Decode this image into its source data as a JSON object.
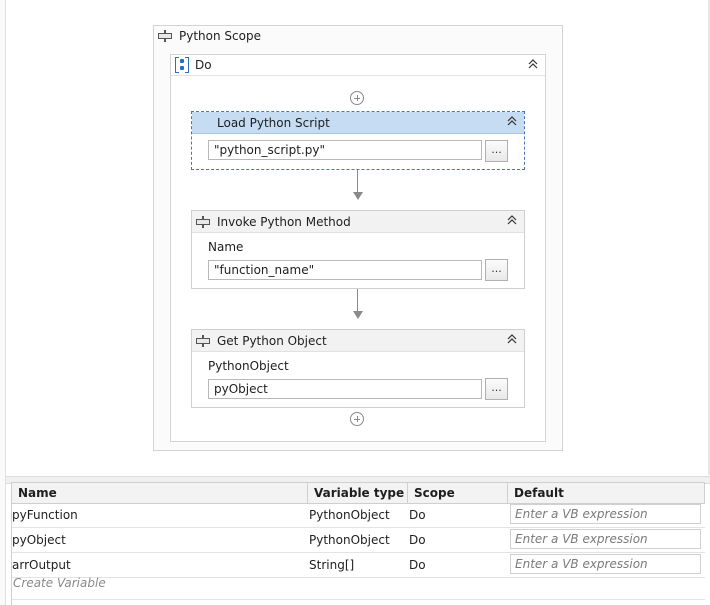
{
  "designer": {
    "scope": {
      "title": "Python Scope"
    },
    "sequence": {
      "title": "Do"
    },
    "activities": [
      {
        "title": "Load Python Script",
        "field_label": "",
        "field_value": "\"python_script.py\"",
        "button_label": "..."
      },
      {
        "title": "Invoke Python Method",
        "field_label": "Name",
        "field_value": "\"function_name\"",
        "button_label": "..."
      },
      {
        "title": "Get Python Object",
        "field_label": "PythonObject",
        "field_value": "pyObject",
        "button_label": "..."
      }
    ]
  },
  "variables": {
    "columns": [
      "Name",
      "Variable type",
      "Scope",
      "Default"
    ],
    "rows": [
      {
        "name": "pyFunction",
        "type": "PythonObject",
        "scope": "Do",
        "default_placeholder": "Enter a VB expression"
      },
      {
        "name": "pyObject",
        "type": "PythonObject",
        "scope": "Do",
        "default_placeholder": "Enter a VB expression"
      },
      {
        "name": "arrOutput",
        "type": "String[]",
        "scope": "Do",
        "default_placeholder": "Enter a VB expression"
      }
    ],
    "create_label": "Create Variable"
  }
}
